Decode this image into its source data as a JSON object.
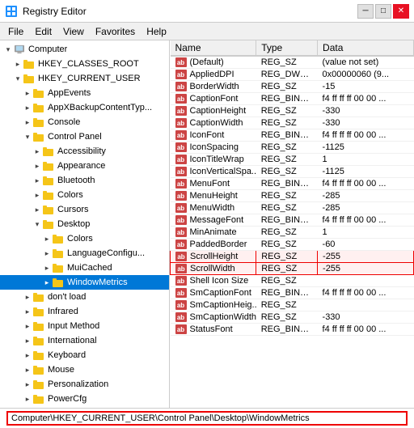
{
  "titleBar": {
    "title": "Registry Editor",
    "icon": "registry-icon",
    "buttons": [
      "minimize",
      "maximize",
      "close"
    ]
  },
  "menuBar": {
    "items": [
      "File",
      "Edit",
      "View",
      "Favorites",
      "Help"
    ]
  },
  "tree": {
    "items": [
      {
        "id": "computer",
        "label": "Computer",
        "indent": 0,
        "expanded": true,
        "type": "computer"
      },
      {
        "id": "classes_root",
        "label": "HKEY_CLASSES_ROOT",
        "indent": 1,
        "expanded": false,
        "type": "hkey"
      },
      {
        "id": "current_user",
        "label": "HKEY_CURRENT_USER",
        "indent": 1,
        "expanded": true,
        "type": "hkey"
      },
      {
        "id": "appevents",
        "label": "AppEvents",
        "indent": 2,
        "expanded": false,
        "type": "folder"
      },
      {
        "id": "appbackup",
        "label": "AppXBackupContentTyp...",
        "indent": 2,
        "expanded": false,
        "type": "folder"
      },
      {
        "id": "console",
        "label": "Console",
        "indent": 2,
        "expanded": false,
        "type": "folder"
      },
      {
        "id": "controlpanel",
        "label": "Control Panel",
        "indent": 2,
        "expanded": true,
        "type": "folder"
      },
      {
        "id": "accessibility",
        "label": "Accessibility",
        "indent": 3,
        "expanded": false,
        "type": "folder"
      },
      {
        "id": "appearance",
        "label": "Appearance",
        "indent": 3,
        "expanded": false,
        "type": "folder"
      },
      {
        "id": "bluetooth",
        "label": "Bluetooth",
        "indent": 3,
        "expanded": false,
        "type": "folder"
      },
      {
        "id": "colors",
        "label": "Colors",
        "indent": 3,
        "expanded": false,
        "type": "folder"
      },
      {
        "id": "cursors",
        "label": "Cursors",
        "indent": 3,
        "expanded": false,
        "type": "folder"
      },
      {
        "id": "desktop",
        "label": "Desktop",
        "indent": 3,
        "expanded": true,
        "type": "folder"
      },
      {
        "id": "colors2",
        "label": "Colors",
        "indent": 4,
        "expanded": false,
        "type": "folder"
      },
      {
        "id": "langconfig",
        "label": "LanguageConfigu...",
        "indent": 4,
        "expanded": false,
        "type": "folder"
      },
      {
        "id": "muicached",
        "label": "MuiCached",
        "indent": 4,
        "expanded": false,
        "type": "folder"
      },
      {
        "id": "windowmetrics",
        "label": "WindowMetrics",
        "indent": 4,
        "expanded": false,
        "type": "folder",
        "selected": true
      },
      {
        "id": "dontload",
        "label": "don't load",
        "indent": 2,
        "expanded": false,
        "type": "folder"
      },
      {
        "id": "infrared",
        "label": "Infrared",
        "indent": 2,
        "expanded": false,
        "type": "folder"
      },
      {
        "id": "inputmethod",
        "label": "Input Method",
        "indent": 2,
        "expanded": false,
        "type": "folder"
      },
      {
        "id": "international",
        "label": "International",
        "indent": 2,
        "expanded": false,
        "type": "folder"
      },
      {
        "id": "keyboard",
        "label": "Keyboard",
        "indent": 2,
        "expanded": false,
        "type": "folder"
      },
      {
        "id": "mouse",
        "label": "Mouse",
        "indent": 2,
        "expanded": false,
        "type": "folder"
      },
      {
        "id": "personalization",
        "label": "Personalization",
        "indent": 2,
        "expanded": false,
        "type": "folder"
      },
      {
        "id": "powercfg",
        "label": "PowerCfg",
        "indent": 2,
        "expanded": false,
        "type": "folder"
      }
    ]
  },
  "table": {
    "columns": [
      "Name",
      "Type",
      "Data"
    ],
    "rows": [
      {
        "name": "(Default)",
        "type": "REG_SZ",
        "data": "(value not set)",
        "icon": "ab"
      },
      {
        "name": "AppliedDPI",
        "type": "REG_DWORD",
        "data": "0x00000060 (9...",
        "icon": "ab"
      },
      {
        "name": "BorderWidth",
        "type": "REG_SZ",
        "data": "-15",
        "icon": "ab"
      },
      {
        "name": "CaptionFont",
        "type": "REG_BINARY",
        "data": "f4 ff ff ff 00 00 ...",
        "icon": "ab"
      },
      {
        "name": "CaptionHeight",
        "type": "REG_SZ",
        "data": "-330",
        "icon": "ab"
      },
      {
        "name": "CaptionWidth",
        "type": "REG_SZ",
        "data": "-330",
        "icon": "ab"
      },
      {
        "name": "IconFont",
        "type": "REG_BINARY",
        "data": "f4 ff ff ff 00 00 ...",
        "icon": "ab"
      },
      {
        "name": "IconSpacing",
        "type": "REG_SZ",
        "data": "-1125",
        "icon": "ab"
      },
      {
        "name": "IconTitleWrap",
        "type": "REG_SZ",
        "data": "1",
        "icon": "ab"
      },
      {
        "name": "IconVerticalSpa...",
        "type": "REG_SZ",
        "data": "-1125",
        "icon": "ab"
      },
      {
        "name": "MenuFont",
        "type": "REG_BINARY",
        "data": "f4 ff ff ff 00 00 ...",
        "icon": "ab"
      },
      {
        "name": "MenuHeight",
        "type": "REG_SZ",
        "data": "-285",
        "icon": "ab"
      },
      {
        "name": "MenuWidth",
        "type": "REG_SZ",
        "data": "-285",
        "icon": "ab"
      },
      {
        "name": "MessageFont",
        "type": "REG_BINARY",
        "data": "f4 ff ff ff 00 00 ...",
        "icon": "ab"
      },
      {
        "name": "MinAnimate",
        "type": "REG_SZ",
        "data": "1",
        "icon": "ab"
      },
      {
        "name": "PaddedBorder",
        "type": "REG_SZ",
        "data": "-60",
        "icon": "ab"
      },
      {
        "name": "ScrollHeight",
        "type": "REG_SZ",
        "data": "-255",
        "icon": "ab",
        "highlighted": true
      },
      {
        "name": "ScrollWidth",
        "type": "REG_SZ",
        "data": "-255",
        "icon": "ab",
        "highlighted": true
      },
      {
        "name": "Shell Icon Size",
        "type": "REG_SZ",
        "data": "",
        "icon": "ab"
      },
      {
        "name": "SmCaptionFont",
        "type": "REG_BINARY",
        "data": "f4 ff ff ff 00 00 ...",
        "icon": "ab"
      },
      {
        "name": "SmCaptionHeig...",
        "type": "REG_SZ",
        "data": "",
        "icon": "ab"
      },
      {
        "name": "SmCaptionWidth",
        "type": "REG_SZ",
        "data": "-330",
        "icon": "ab"
      },
      {
        "name": "StatusFont",
        "type": "REG_BINARY",
        "data": "f4 ff ff ff 00 00 ...",
        "icon": "ab"
      }
    ]
  },
  "statusBar": {
    "path": "Computer\\HKEY_CURRENT_USER\\Control Panel\\Desktop\\WindowMetrics"
  }
}
